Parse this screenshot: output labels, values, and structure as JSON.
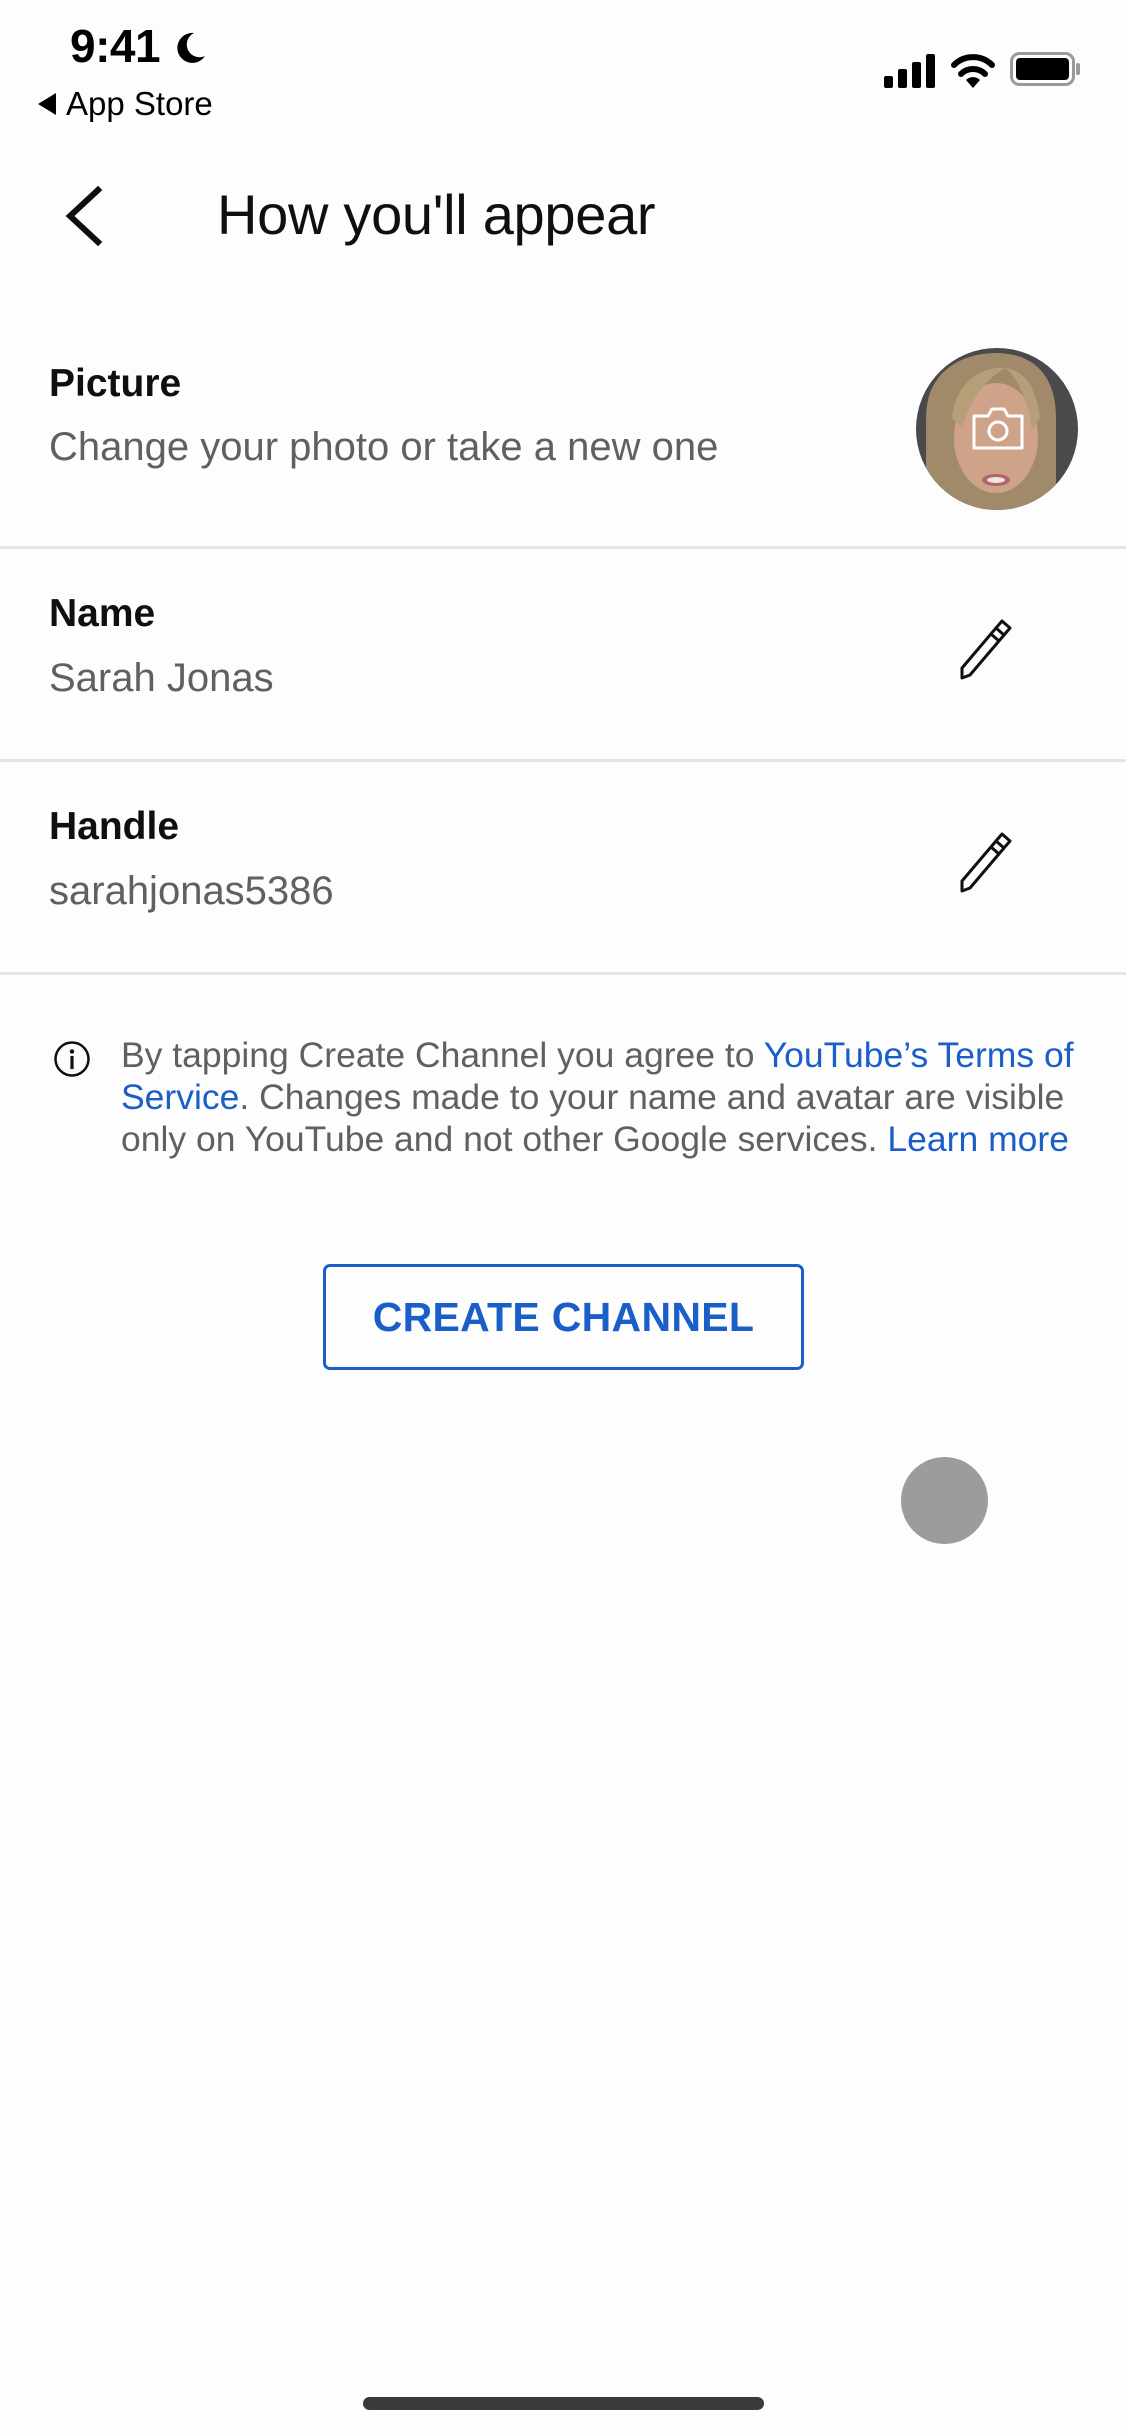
{
  "status_bar": {
    "time": "9:41",
    "back_app": "App Store",
    "icons": [
      "moon-icon",
      "cellular-signal-icon",
      "wifi-icon",
      "battery-icon"
    ]
  },
  "header": {
    "back_icon": "chevron-left-icon",
    "title": "How you'll appear"
  },
  "picture": {
    "label": "Picture",
    "description": "Change your photo or take a new one",
    "overlay_icon": "camera-icon"
  },
  "name": {
    "label": "Name",
    "value": "Sarah Jonas",
    "edit_icon": "pencil-icon"
  },
  "handle": {
    "label": "Handle",
    "value": "sarahjonas5386",
    "edit_icon": "pencil-icon"
  },
  "info": {
    "icon": "info-icon",
    "text_before": "By tapping Create Channel you agree to ",
    "terms_link": "YouTube’s Terms of Service",
    "text_middle": ". Changes made to your name and avatar are visible only on YouTube and not other Google services. ",
    "learn_more_link": "Learn more"
  },
  "create_button": {
    "label": "CREATE CHANNEL"
  },
  "colors": {
    "accent": "#1a5ec8",
    "secondary_text": "#606060",
    "divider": "#e6e4e6",
    "touch_indicator": "#9d9b9e"
  }
}
